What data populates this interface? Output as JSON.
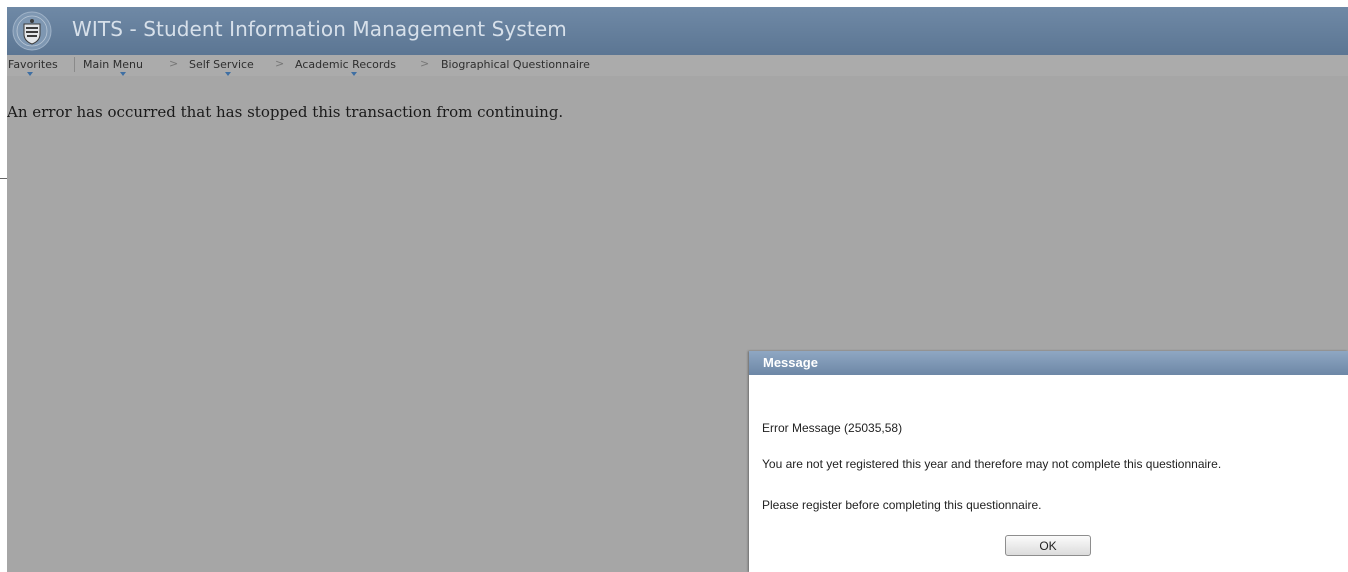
{
  "header": {
    "app_title": "WITS - Student Information Management System",
    "logo_icon": "university-crest-icon"
  },
  "nav": {
    "favorites": "Favorites",
    "main_menu": "Main Menu",
    "separator": ">",
    "self_service": "Self Service",
    "academic_records": "Academic Records",
    "current_page": "Biographical Questionnaire",
    "caret_icon": "dropdown-caret-icon"
  },
  "page": {
    "error_text": "An error has occurred that has stopped this transaction from continuing."
  },
  "dialog": {
    "title": "Message",
    "error_code": "Error Message (25035,58)",
    "line1": "You are not yet registered this year and therefore may not complete this questionnaire.",
    "line2": "Please register before completing this questionnaire.",
    "ok_label": "OK"
  },
  "colors": {
    "banner": "#5c7693",
    "banner_text": "#d7e0ea",
    "page_background": "#a6a6a6",
    "dialog_header": "#6d87a6",
    "dialog_body": "#ffffff"
  }
}
